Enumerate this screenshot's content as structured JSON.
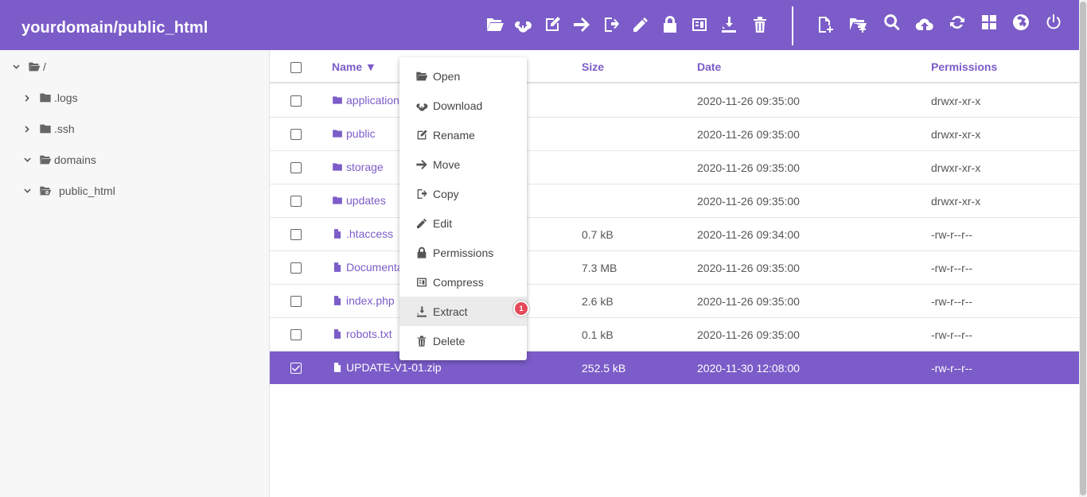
{
  "header": {
    "title": "yourdomain/public_html",
    "bg_color": "#7b5cc8",
    "actions": [
      {
        "icon": "folder-open-icon"
      },
      {
        "icon": "cloud-download-icon"
      },
      {
        "icon": "rename-icon"
      },
      {
        "icon": "arrow-right-icon"
      },
      {
        "icon": "copy-icon"
      },
      {
        "icon": "pencil-icon"
      },
      {
        "icon": "lock-icon"
      },
      {
        "icon": "compress-icon"
      },
      {
        "icon": "extract-icon"
      },
      {
        "icon": "trash-icon"
      },
      {
        "icon": "new-file-icon"
      },
      {
        "icon": "new-folder-icon"
      },
      {
        "icon": "search-icon"
      },
      {
        "icon": "cloud-upload-icon"
      },
      {
        "icon": "refresh-icon"
      },
      {
        "icon": "grid-icon"
      },
      {
        "icon": "globe-icon"
      },
      {
        "icon": "power-icon"
      }
    ]
  },
  "sidebar": {
    "tree": [
      {
        "label": "/",
        "expanded": true,
        "icon": "folder-open-icon"
      },
      {
        "label": ".logs",
        "expanded": false,
        "icon": "folder-icon"
      },
      {
        "label": ".ssh",
        "expanded": false,
        "icon": "folder-icon"
      },
      {
        "label": "domains",
        "expanded": true,
        "icon": "folder-open-icon"
      },
      {
        "label": "public_html",
        "expanded": true,
        "icon": "folder-link-icon"
      }
    ]
  },
  "table": {
    "columns": {
      "name": "Name ▼",
      "size": "Size",
      "date": "Date",
      "permissions": "Permissions"
    },
    "rows": [
      {
        "name": "application",
        "type": "folder",
        "size": "",
        "date": "2020-11-26 09:35:00",
        "permissions": "drwxr-xr-x",
        "selected": false
      },
      {
        "name": "public",
        "type": "folder",
        "size": "",
        "date": "2020-11-26 09:35:00",
        "permissions": "drwxr-xr-x",
        "selected": false
      },
      {
        "name": "storage",
        "type": "folder",
        "size": "",
        "date": "2020-11-26 09:35:00",
        "permissions": "drwxr-xr-x",
        "selected": false
      },
      {
        "name": "updates",
        "type": "folder",
        "size": "",
        "date": "2020-11-26 09:35:00",
        "permissions": "drwxr-xr-x",
        "selected": false
      },
      {
        "name": ".htaccess",
        "type": "file",
        "size": "0.7 kB",
        "date": "2020-11-26 09:34:00",
        "permissions": "-rw-r--r--",
        "selected": false
      },
      {
        "name": "Documenta",
        "type": "file",
        "size": "7.3 MB",
        "date": "2020-11-26 09:35:00",
        "permissions": "-rw-r--r--",
        "selected": false
      },
      {
        "name": "index.php",
        "type": "file",
        "size": "2.6 kB",
        "date": "2020-11-26 09:35:00",
        "permissions": "-rw-r--r--",
        "selected": false
      },
      {
        "name": "robots.txt",
        "type": "file",
        "size": "0.1 kB",
        "date": "2020-11-26 09:35:00",
        "permissions": "-rw-r--r--",
        "selected": false
      },
      {
        "name": "UPDATE-V1-01.zip",
        "type": "file",
        "size": "252.5 kB",
        "date": "2020-11-30 12:08:00",
        "permissions": "-rw-r--r--",
        "selected": true
      }
    ]
  },
  "context_menu": {
    "items": [
      {
        "label": "Open",
        "icon": "folder-open-icon"
      },
      {
        "label": "Download",
        "icon": "cloud-download-icon"
      },
      {
        "label": "Rename",
        "icon": "rename-icon"
      },
      {
        "label": "Move",
        "icon": "arrow-right-icon"
      },
      {
        "label": "Copy",
        "icon": "copy-icon"
      },
      {
        "label": "Edit",
        "icon": "pencil-icon"
      },
      {
        "label": "Permissions",
        "icon": "lock-icon"
      },
      {
        "label": "Compress",
        "icon": "compress-icon"
      },
      {
        "label": "Extract",
        "icon": "extract-icon",
        "hovered": true
      },
      {
        "label": "Delete",
        "icon": "trash-icon"
      }
    ],
    "badge": "1",
    "badge_color": "#e44a5a"
  }
}
